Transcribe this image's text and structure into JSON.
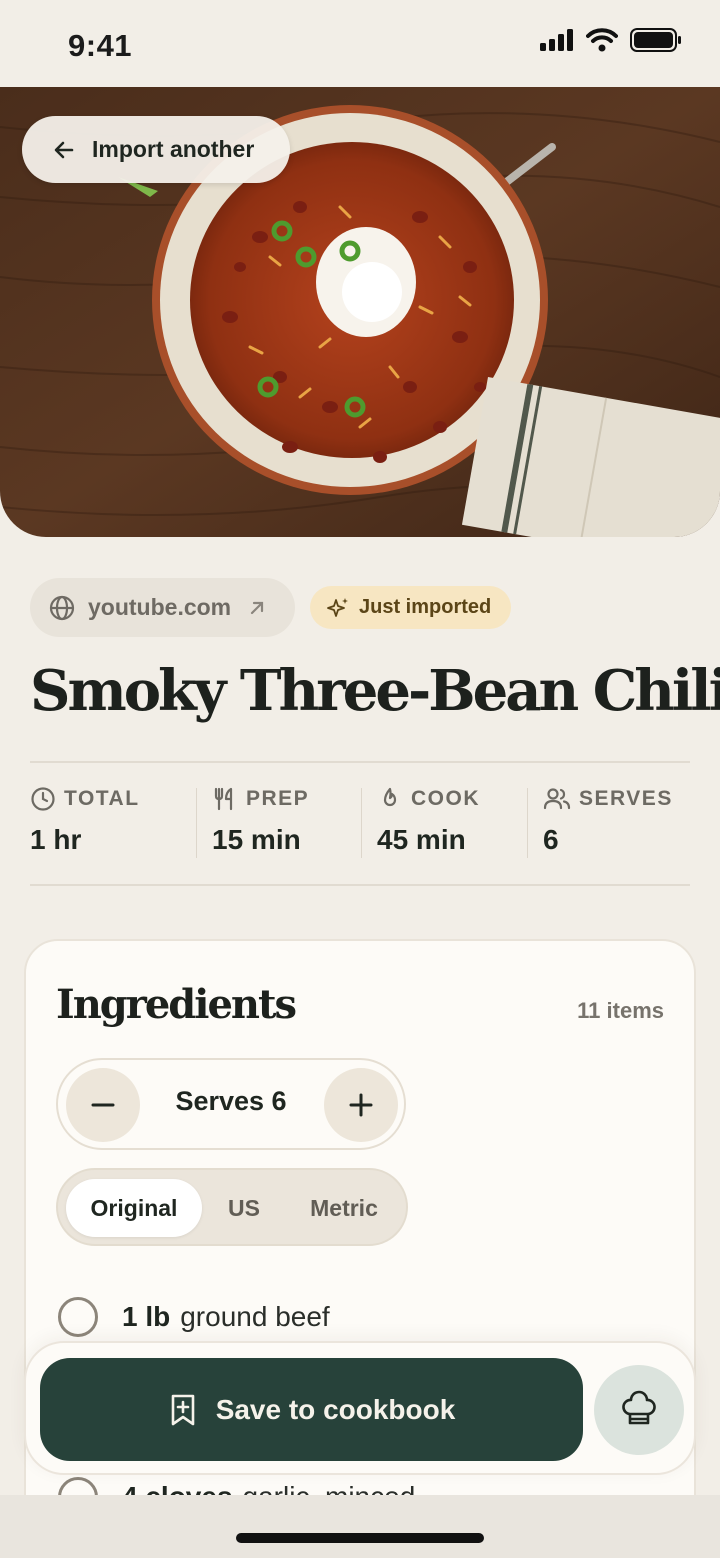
{
  "status_bar": {
    "time": "9:41"
  },
  "header": {
    "back_label": "Import another"
  },
  "source": {
    "domain": "youtube.com",
    "badge": "Just imported"
  },
  "recipe": {
    "title": "Smoky Three-Bean Chili"
  },
  "stats": [
    {
      "icon": "clock-icon",
      "label": "TOTAL",
      "value": "1 hr"
    },
    {
      "icon": "utensils-icon",
      "label": "PREP",
      "value": "15 min"
    },
    {
      "icon": "flame-icon",
      "label": "COOK",
      "value": "45 min"
    },
    {
      "icon": "people-icon",
      "label": "SERVES",
      "value": "6"
    }
  ],
  "ingredients": {
    "title": "Ingredients",
    "count": "11 items",
    "serves_label": "Serves 6",
    "units": {
      "options": [
        "Original",
        "US",
        "Metric"
      ],
      "selected": "Original"
    },
    "items": [
      {
        "qty": "1 lb",
        "name": "ground beef"
      },
      {
        "qty": "4 cloves",
        "name": "garlic, minced"
      }
    ]
  },
  "actions": {
    "save_label": "Save to cookbook",
    "chef_icon": "chef-hat-icon"
  },
  "colors": {
    "primary": "#27423a",
    "background": "#f2eee7",
    "badge": "#f7e6c2"
  }
}
